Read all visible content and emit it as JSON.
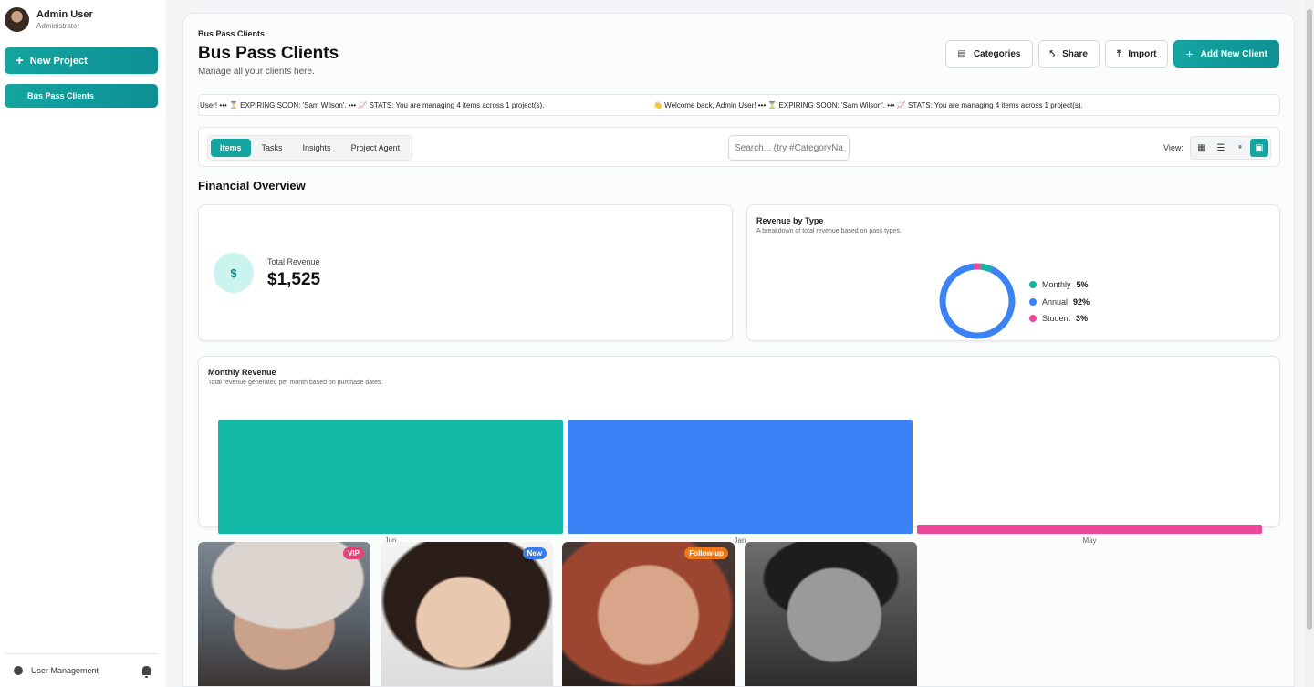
{
  "sidebar": {
    "user_name": "Admin User",
    "user_role": "Administrator",
    "new_project_label": "New Project",
    "nav_items": [
      {
        "label": "Bus Pass Clients"
      }
    ],
    "footer_label": "User Management"
  },
  "header": {
    "breadcrumb": "Bus Pass Clients",
    "title": "Bus Pass Clients",
    "subtitle": "Manage all your clients here.",
    "buttons": {
      "categories": "Categories",
      "share": "Share",
      "import": "Import",
      "add_client": "Add New Client"
    }
  },
  "ticker": {
    "segment_a": "User! ••• ⏳ EXPIRING SOON: 'Sam Wilson'. ••• 📈 STATS: You are managing 4 items across 1 project(s).",
    "segment_b": "👋 Welcome back, Admin User! ••• ⏳ EXPIRING SOON: 'Sam Wilson'. ••• 📈 STATS: You are managing 4 items across 1 project(s)."
  },
  "controls": {
    "tabs": [
      {
        "label": "Items"
      },
      {
        "label": "Tasks"
      },
      {
        "label": "Insights"
      },
      {
        "label": "Project Agent"
      }
    ],
    "active_tab": "Items",
    "search_placeholder": "Search... (try #CategoryName)",
    "view_label": "View:"
  },
  "overview": {
    "title": "Financial Overview",
    "total_revenue_label": "Total Revenue",
    "total_revenue_value": "$1,525",
    "currency_symbol": "$"
  },
  "revenue_by_type": {
    "title": "Revenue by Type",
    "description": "A breakdown of total revenue based on pass types.",
    "legend": [
      {
        "label": "Monthly",
        "value": "5%"
      },
      {
        "label": "Annual",
        "value": "92%"
      },
      {
        "label": "Student",
        "value": "3%"
      }
    ]
  },
  "monthly_revenue": {
    "title": "Monthly Revenue",
    "description": "Total revenue generated per month based on purchase dates."
  },
  "chart_data": [
    {
      "type": "pie",
      "categories": [
        "Monthly",
        "Annual",
        "Student"
      ],
      "values": [
        5,
        92,
        3
      ],
      "colors": [
        "#14b3a3",
        "#3b82f6",
        "#ec4899"
      ],
      "legend": "right"
    },
    {
      "type": "bar",
      "categories": [
        "Jun",
        "Jan",
        "May"
      ],
      "values": [
        100,
        100,
        8
      ],
      "colors": [
        "#14b8a6",
        "#3b82f6",
        "#ec4899"
      ]
    }
  ],
  "gallery": [
    {
      "badge": "VIP"
    },
    {
      "badge": "New"
    },
    {
      "badge": "Follow-up"
    },
    {
      "badge": ""
    }
  ],
  "colors": {
    "accent": "#14a5a0",
    "monthly": "#14b3a3",
    "annual": "#3b82f6",
    "student": "#ec4899"
  }
}
